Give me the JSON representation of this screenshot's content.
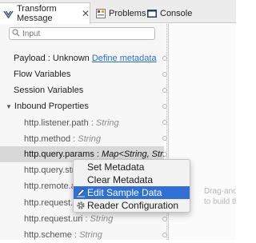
{
  "tabs": [
    {
      "label": "Transform Message",
      "close": "✕"
    },
    {
      "label": "Problems"
    },
    {
      "label": "Console"
    }
  ],
  "search": {
    "placeholder": "Input"
  },
  "tree": {
    "payload": {
      "label": "Payload : Unknown",
      "link": "Define metadata"
    },
    "flow_vars": "Flow Variables",
    "session_vars": "Session Variables",
    "inbound": "Inbound Properties",
    "items": [
      {
        "name": "http.listener.path",
        "type": "String"
      },
      {
        "name": "http.method",
        "type": "String"
      },
      {
        "name": "http.query.params",
        "type": "Map<String, String>"
      },
      {
        "name": "http.query.strin",
        "type": ""
      },
      {
        "name": "http.remote.ad",
        "type": ""
      },
      {
        "name": "http.request.pa",
        "type": ""
      },
      {
        "name": "http.request.uri",
        "type": "String"
      },
      {
        "name": "http.scheme",
        "type": "String"
      }
    ]
  },
  "context_menu": {
    "items": [
      "Set Metadata",
      "Clear Metadata",
      "Edit Sample Data",
      "Reader Configuration"
    ]
  },
  "hint": [
    "Drag-and",
    "to build th"
  ],
  "colors": {
    "highlight": "#2f6fd6",
    "link": "#2a6fc9"
  }
}
